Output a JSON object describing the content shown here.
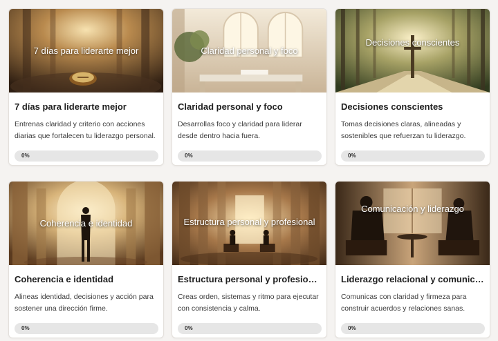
{
  "courses": [
    {
      "overlay_title": "7 días para liderarte mejor",
      "title": "7 días para liderarte mejor",
      "description": "Entrenas claridad y criterio con acciones diarias que fortalecen tu liderazgo personal.",
      "progress_label": "0%",
      "progress": 0
    },
    {
      "overlay_title": "Claridad personal y foco",
      "title": "Claridad personal y foco",
      "description": "Desarrollas foco y claridad para liderar desde dentro hacia fuera.",
      "progress_label": "0%",
      "progress": 0
    },
    {
      "overlay_title": "Decisiones conscientes",
      "title": "Decisiones conscientes",
      "description": "Tomas decisiones claras, alineadas y sostenibles que refuerzan tu liderazgo.",
      "progress_label": "0%",
      "progress": 0
    },
    {
      "overlay_title": "Coherencia e identidad",
      "title": "Coherencia e identidad",
      "description": "Alineas identidad, decisiones y acción para sostener una dirección firme.",
      "progress_label": "0%",
      "progress": 0
    },
    {
      "overlay_title": "Estructura personal y profesional",
      "title": "Estructura personal y profesional",
      "description": "Creas orden, sistemas y ritmo para ejecutar con consistencia y calma.",
      "progress_label": "0%",
      "progress": 0
    },
    {
      "overlay_title": "Comunicación y liderazgo",
      "title": "Liderazgo relacional y comunicaci...",
      "description": "Comunicas con claridad y firmeza para construir acuerdos y relaciones sanas.",
      "progress_label": "0%",
      "progress": 0
    }
  ]
}
